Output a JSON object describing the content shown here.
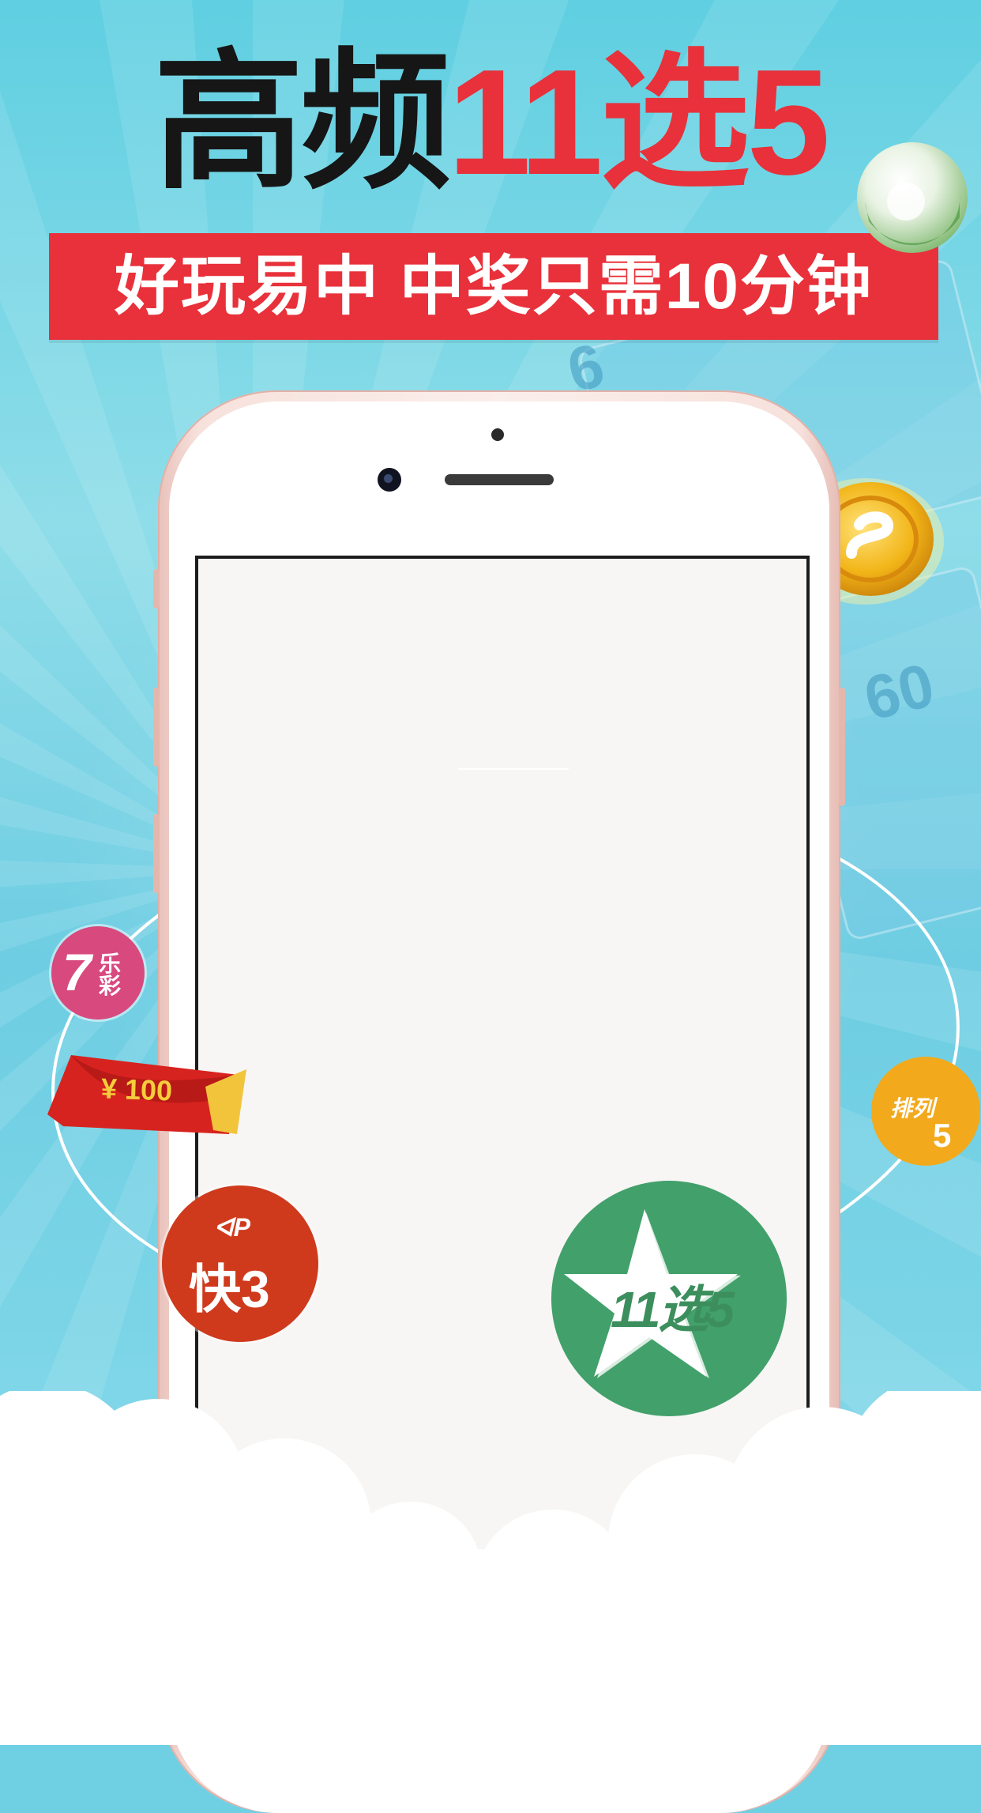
{
  "headline": {
    "part1": "高频",
    "part2": "11选",
    "part3": "5"
  },
  "banner": {
    "text": "好玩易中 中奖只需10分钟"
  },
  "badges": {
    "qilecai": {
      "big": "7",
      "small": "乐彩"
    },
    "redpacket": "¥ 100",
    "kuai3": {
      "mark": "ᐊP",
      "text": "快3"
    },
    "pailie5": {
      "text": "排列",
      "num": "5"
    },
    "xuan11x5": "11选5"
  },
  "background_numbers": [
    "6",
    "60"
  ],
  "colors": {
    "headline_dark": "#161616",
    "accent_red": "#e8313a",
    "background_cyan": "#6fd0e4",
    "kuai3": "#cf3a1d",
    "qilecai": "#d8497e",
    "pailie5": "#f2a91c",
    "xuan11x5": "#42a06b"
  }
}
